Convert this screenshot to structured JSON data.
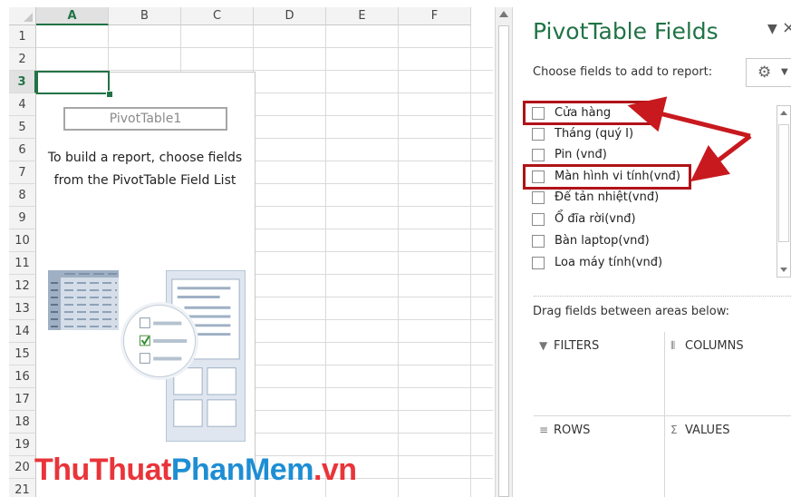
{
  "sheet": {
    "columns": [
      "A",
      "B",
      "C",
      "D",
      "E",
      "F"
    ],
    "rows": [
      "1",
      "2",
      "3",
      "4",
      "5",
      "6",
      "7",
      "8",
      "9",
      "10",
      "11",
      "12",
      "13",
      "14",
      "15",
      "16",
      "17",
      "18",
      "19",
      "20",
      "21"
    ],
    "selected_column": "A",
    "selected_row": "3",
    "pivot_name": "PivotTable1",
    "pivot_instructions": "To build a report, choose fields from the PivotTable Field List"
  },
  "watermark": {
    "part1": "ThuThuat",
    "part2": "PhanMem",
    "part3": ".vn"
  },
  "pane": {
    "title": "PivotTable Fields",
    "choose_label": "Choose fields to add to report:",
    "fields": [
      {
        "label": "Cửa hàng",
        "checked": false,
        "highlighted": true
      },
      {
        "label": "Tháng  (quý I)",
        "checked": false,
        "highlighted": false
      },
      {
        "label": "Pin (vnđ)",
        "checked": false,
        "highlighted": false
      },
      {
        "label": "Màn hình vi tính(vnđ)",
        "checked": false,
        "highlighted": true
      },
      {
        "label": "Đế tản nhiệt(vnđ)",
        "checked": false,
        "highlighted": false
      },
      {
        "label": "Ổ đĩa rời(vnđ)",
        "checked": false,
        "highlighted": false
      },
      {
        "label": "Bàn laptop(vnđ)",
        "checked": false,
        "highlighted": false
      },
      {
        "label": "Loa máy tính(vnđ)",
        "checked": false,
        "highlighted": false
      }
    ],
    "drag_label": "Drag fields between areas below:",
    "areas": {
      "filters": "FILTERS",
      "columns": "COLUMNS",
      "rows": "ROWS",
      "values": "VALUES"
    }
  },
  "colors": {
    "accent": "#217346",
    "highlight": "#b01318",
    "watermark_red": "#e9343a",
    "watermark_blue": "#1e8ed3"
  }
}
